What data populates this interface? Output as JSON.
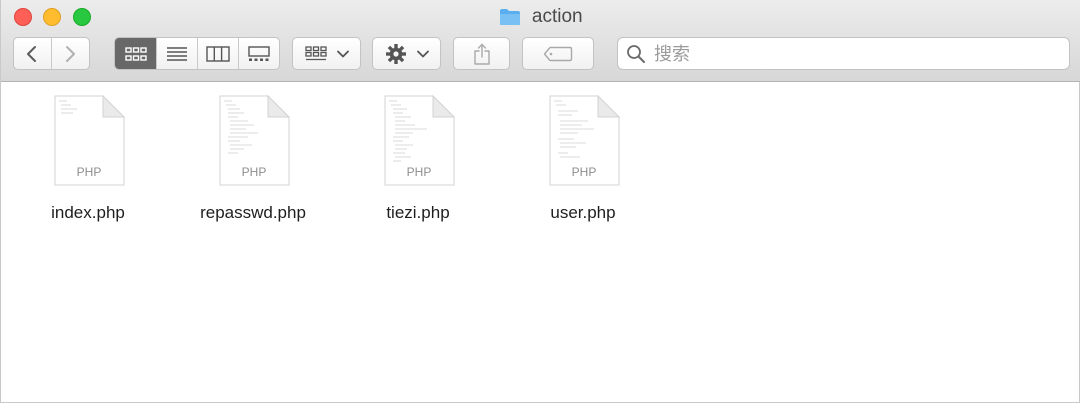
{
  "window": {
    "title": "action",
    "title_icon": "folder-icon"
  },
  "traffic_lights": [
    {
      "name": "close",
      "color": "#fe5f57"
    },
    {
      "name": "minimize",
      "color": "#febc2e"
    },
    {
      "name": "zoom",
      "color": "#28c840"
    }
  ],
  "toolbar": {
    "back_icon": "chevron-left-icon",
    "forward_icon": "chevron-right-icon",
    "view_modes": [
      "icon-view",
      "list-view",
      "column-view",
      "gallery-view"
    ],
    "active_view": "icon-view",
    "group_icon": "group-by-icon",
    "action_icon": "gear-icon",
    "share_icon": "share-icon",
    "tag_icon": "tag-icon"
  },
  "search": {
    "placeholder": "搜索",
    "value": ""
  },
  "files": [
    {
      "name": "index.php",
      "ext": "PHP"
    },
    {
      "name": "repasswd.php",
      "ext": "PHP"
    },
    {
      "name": "tiezi.php",
      "ext": "PHP"
    },
    {
      "name": "user.php",
      "ext": "PHP"
    }
  ],
  "colors": {
    "accent_folder": "#5aaef0",
    "active_segment": "#686868"
  }
}
